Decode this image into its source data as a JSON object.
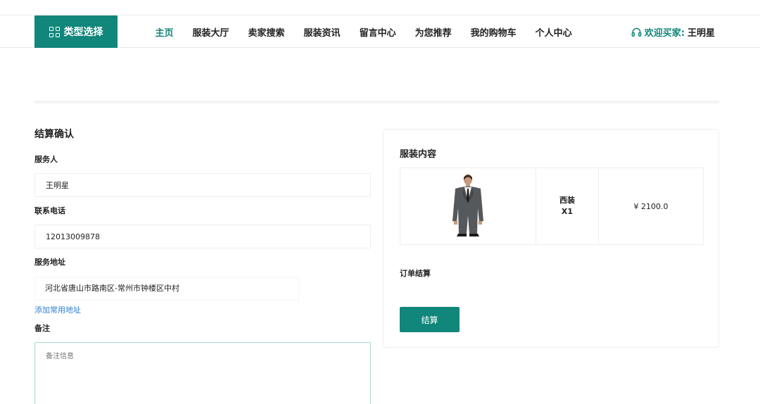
{
  "header": {
    "category_button": "类型选择",
    "nav": [
      "主页",
      "服装大厅",
      "卖家搜索",
      "服装资讯",
      "留言中心",
      "为您推荐",
      "我的购物车",
      "个人中心"
    ],
    "active_nav": "主页",
    "welcome_label": "欢迎买家:",
    "username": "王明星"
  },
  "form": {
    "title": "结算确认",
    "server_label": "服务人",
    "server_value": "王明星",
    "phone_label": "联系电话",
    "phone_value": "12013009878",
    "address_label": "服务地址",
    "address_value": "河北省唐山市路南区-常州市钟楼区中村",
    "add_address_link": "添加常用地址",
    "remark_label": "备注",
    "remark_placeholder": "备注信息"
  },
  "order": {
    "title": "服装内容",
    "item": {
      "image": "suit-photo",
      "name": "西装",
      "quantity": "X1",
      "price": "¥ 2100.0"
    },
    "summary_label": "订单结算",
    "checkout_button": "结算"
  },
  "colors": {
    "accent": "#11867a",
    "link": "#2a7fd4"
  }
}
